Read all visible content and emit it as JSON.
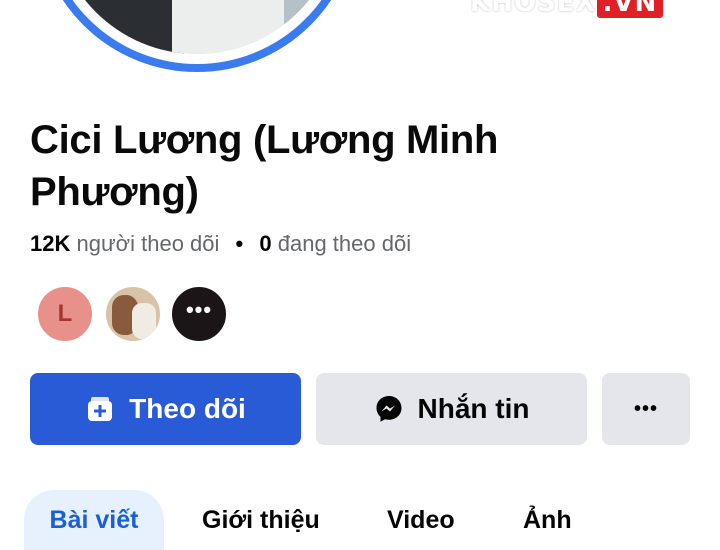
{
  "watermark": {
    "part_a": "KHOSEX",
    "part_b": ".VN"
  },
  "profile": {
    "name": "Cici Lương (Lương Minh Phương)",
    "followers_count": "12K",
    "followers_label": "người theo dõi",
    "separator": "•",
    "following_count": "0",
    "following_label": "đang theo dõi"
  },
  "mutual": {
    "first_initial": "L",
    "more_label": "•••"
  },
  "actions": {
    "follow_label": "Theo dõi",
    "message_label": "Nhắn tin",
    "more_label": "•••"
  },
  "tabs": [
    {
      "label": "Bài viết",
      "active": true
    },
    {
      "label": "Giới thiệu",
      "active": false
    },
    {
      "label": "Video",
      "active": false
    },
    {
      "label": "Ảnh",
      "active": false
    }
  ],
  "colors": {
    "accent": "#2a5bd7",
    "ring": "#3b7bf0",
    "button_gray": "#e4e6eb",
    "tab_active_bg": "#e7f0fd"
  }
}
